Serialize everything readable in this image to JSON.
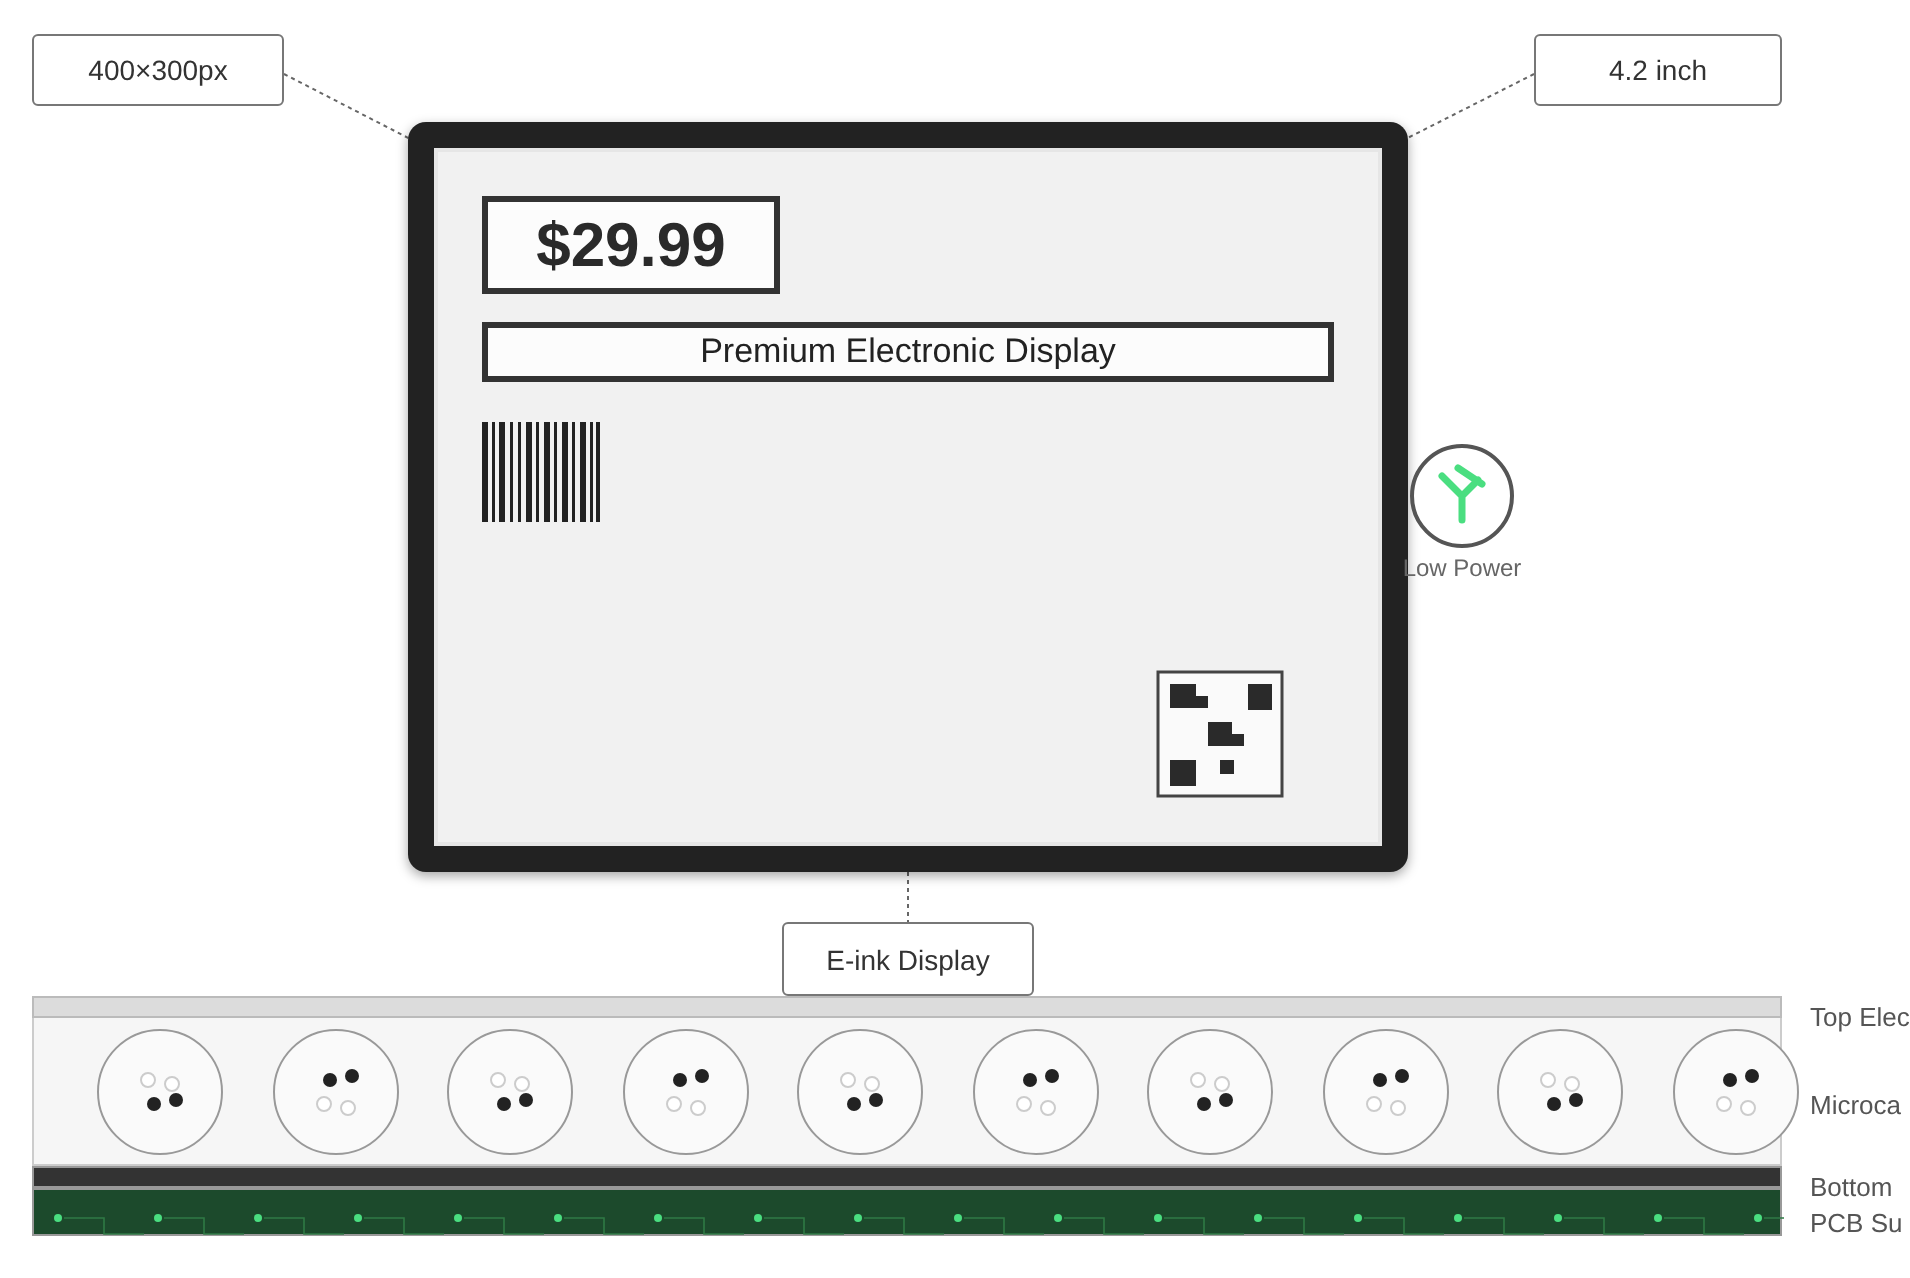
{
  "callouts": [
    {
      "text": "400×300px"
    },
    {
      "text": "4.2 inch"
    }
  ],
  "display": {
    "price": "$29.99",
    "product_name": "Premium Electronic Display"
  },
  "power_badge": {
    "label": "Low Power"
  },
  "display_label": "E-ink Display",
  "layers": [
    {
      "kind": "top-electrode",
      "label": "Top Elec"
    },
    {
      "kind": "microcapsule",
      "label": "Microca"
    },
    {
      "kind": "bottom-electrode",
      "label": "Bottom"
    },
    {
      "kind": "pcb",
      "label": "PCB Su"
    }
  ],
  "microcapsules": [
    {
      "kind": "dark-bottom"
    },
    {
      "kind": "dark-top"
    },
    {
      "kind": "dark-bottom"
    },
    {
      "kind": "dark-top"
    },
    {
      "kind": "dark-bottom"
    },
    {
      "kind": "dark-top"
    },
    {
      "kind": "dark-bottom"
    },
    {
      "kind": "dark-top"
    },
    {
      "kind": "dark-bottom"
    },
    {
      "kind": "dark-top"
    }
  ]
}
